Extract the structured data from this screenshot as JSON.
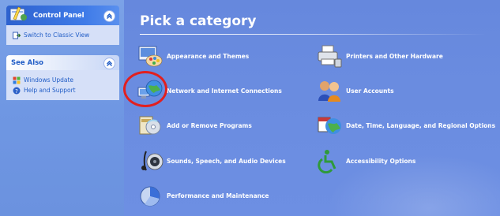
{
  "left_pane": {
    "control_panel": {
      "title": "Control Panel",
      "tasks": [
        {
          "icon": "switch-view-icon",
          "label": "Switch to Classic View"
        }
      ]
    },
    "see_also": {
      "title": "See Also",
      "tasks": [
        {
          "icon": "windows-update-icon",
          "label": "Windows Update"
        },
        {
          "icon": "help-icon",
          "label": "Help and Support"
        }
      ]
    }
  },
  "main": {
    "title": "Pick a category",
    "categories": [
      {
        "label": "Appearance and Themes",
        "icon": "appearance-themes-icon"
      },
      {
        "label": "Printers and Other Hardware",
        "icon": "printer-icon"
      },
      {
        "label": "Network and Internet Connections",
        "icon": "network-globe-icon",
        "highlighted": true
      },
      {
        "label": "User Accounts",
        "icon": "user-accounts-icon"
      },
      {
        "label": "Add or Remove Programs",
        "icon": "add-remove-programs-icon"
      },
      {
        "label": "Date, Time, Language, and Regional Options",
        "icon": "date-time-globe-icon"
      },
      {
        "label": "Sounds, Speech, and Audio Devices",
        "icon": "sounds-speaker-icon"
      },
      {
        "label": "Accessibility Options",
        "icon": "accessibility-icon"
      },
      {
        "label": "Performance and Maintenance",
        "icon": "performance-chart-icon"
      }
    ]
  },
  "colors": {
    "pane_background": "#6f97e3",
    "main_background": "#6a8ce0",
    "link_blue": "#215dc6",
    "highlight_ring": "#e21f1f"
  }
}
